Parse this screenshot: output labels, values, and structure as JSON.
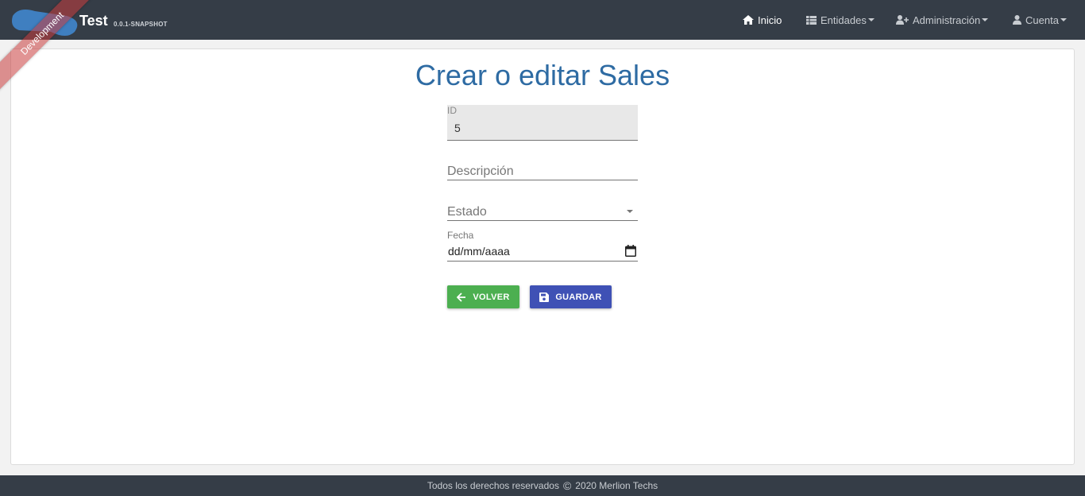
{
  "navbar": {
    "ribbon_label": "Development",
    "brand_title": "Test",
    "brand_version": "0.0.1-SNAPSHOT",
    "items": [
      {
        "label": "Inicio",
        "icon": "home-icon"
      },
      {
        "label": "Entidades",
        "icon": "table-icon"
      },
      {
        "label": "Administración",
        "icon": "user-plus-icon"
      },
      {
        "label": "Cuenta",
        "icon": "user-icon"
      }
    ]
  },
  "main": {
    "title": "Crear o editar Sales",
    "form": {
      "id_label": "ID",
      "id_value": "5",
      "descripcion_placeholder": "Descripción",
      "estado_placeholder": "Estado",
      "fecha_label": "Fecha",
      "fecha_placeholder": "dd/mm/aaaa"
    },
    "buttons": {
      "back_label": "VOLVER",
      "save_label": "GUARDAR"
    }
  },
  "footer": {
    "text_before": "Todos los derechos reservados",
    "copyright_symbol": "©",
    "text_after": "2020 Merlion Techs"
  },
  "colors": {
    "navbar_bg": "#353d47",
    "title": "#2e6ba3",
    "back_button": "#4caf50",
    "save_button": "#3f51b5",
    "ribbon": "#c83c3c"
  }
}
